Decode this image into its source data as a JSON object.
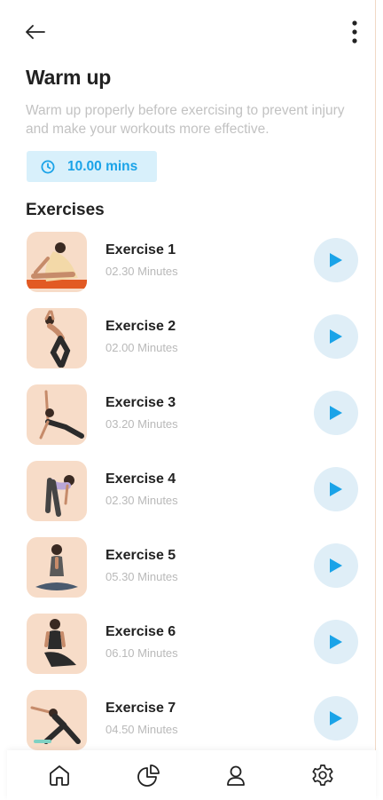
{
  "header": {
    "back_icon": "arrow-left-icon",
    "more_icon": "more-vertical-icon"
  },
  "page": {
    "title": "Warm up",
    "subtitle": "Warm up properly before exercising to prevent injury and make your workouts more effective.",
    "duration": "10.00 mins",
    "duration_icon": "clock-icon",
    "section_title": "Exercises"
  },
  "exercises": [
    {
      "name": "Exercise 1",
      "duration": "02.30 Minutes"
    },
    {
      "name": "Exercise 2",
      "duration": "02.00 Minutes"
    },
    {
      "name": "Exercise 3",
      "duration": "03.20 Minutes"
    },
    {
      "name": "Exercise 4",
      "duration": "02.30 Minutes"
    },
    {
      "name": "Exercise 5",
      "duration": "05.30 Minutes"
    },
    {
      "name": "Exercise 6",
      "duration": "06.10 Minutes"
    },
    {
      "name": "Exercise 7",
      "duration": "04.50 Minutes"
    }
  ],
  "tabbar": [
    {
      "icon": "home-icon"
    },
    {
      "icon": "pie-chart-icon"
    },
    {
      "icon": "user-icon"
    },
    {
      "icon": "settings-icon"
    }
  ],
  "colors": {
    "accent": "#1aa3e8",
    "duration_bg": "#d8f0fb",
    "play_bg": "#dfeef7",
    "thumb_bg": "#f7dcc8",
    "muted_text": "#c2c2c2"
  }
}
